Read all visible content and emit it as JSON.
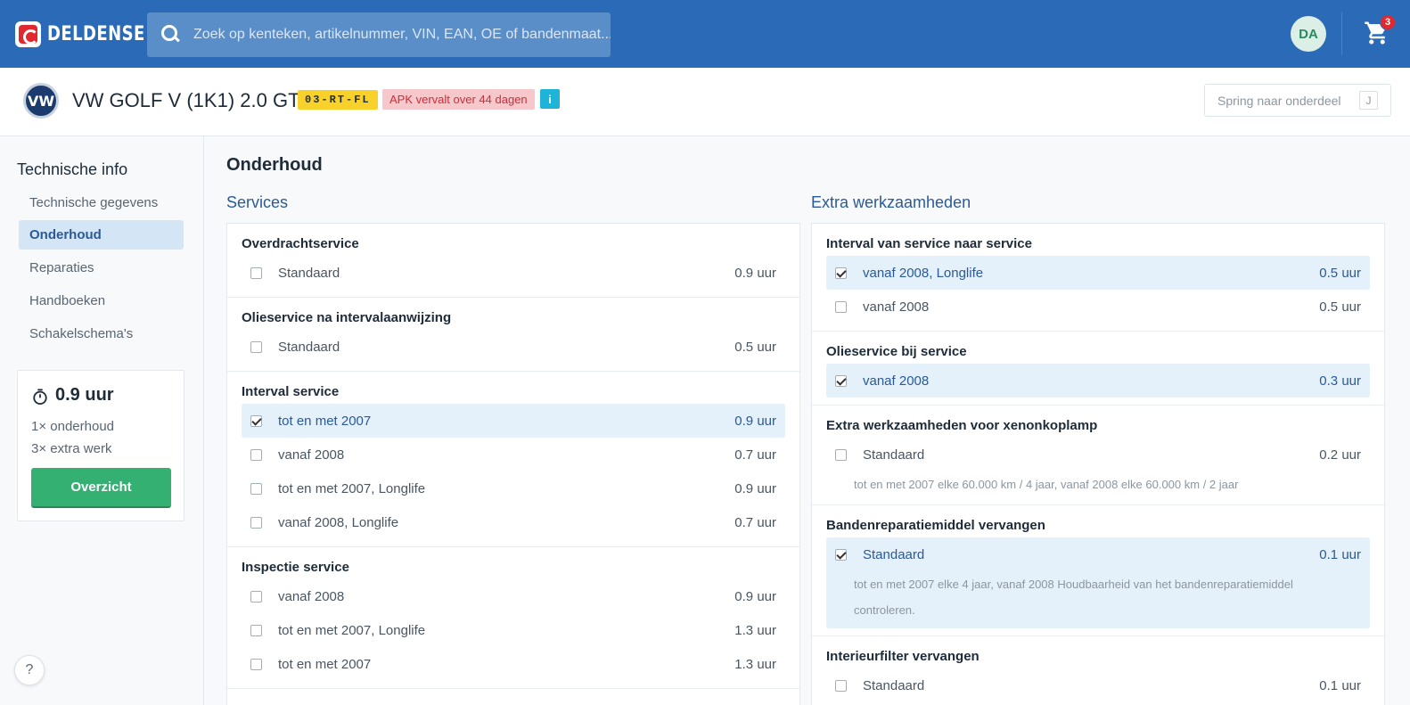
{
  "header": {
    "brand": "DELDENSE",
    "search_placeholder": "Zoek op kenteken, artikelnummer, VIN, EAN, OE of bandenmaat...",
    "avatar_initials": "DA",
    "cart_count": "3"
  },
  "vehicle": {
    "make_logo": "VW",
    "title": "VW GOLF V (1K1) 2.0 GTI",
    "plate": "03-RT-FL",
    "apk": "APK vervalt over 44 dagen",
    "info": "i",
    "jump_label": "Spring naar onderdeel",
    "jump_key": "J"
  },
  "sidebar": {
    "title": "Technische info",
    "items": [
      {
        "label": "Technische gegevens",
        "active": false
      },
      {
        "label": "Onderhoud",
        "active": true
      },
      {
        "label": "Reparaties",
        "active": false
      },
      {
        "label": "Handboeken",
        "active": false
      },
      {
        "label": "Schakelschema's",
        "active": false
      }
    ],
    "summary": {
      "hours": "0.9 uur",
      "line1": "1× onderhoud",
      "line2": "3× extra werk",
      "button": "Overzicht"
    },
    "help": "?"
  },
  "main": {
    "title": "Onderhoud",
    "services_title": "Services",
    "extra_title": "Extra werkzaamheden",
    "services": [
      {
        "title": "Overdrachtservice",
        "options": [
          {
            "label": "Standaard",
            "value": "0.9 uur",
            "checked": false
          }
        ]
      },
      {
        "title": "Olieservice na intervalaanwijzing",
        "options": [
          {
            "label": "Standaard",
            "value": "0.5 uur",
            "checked": false
          }
        ]
      },
      {
        "title": "Interval service",
        "options": [
          {
            "label": "tot en met 2007",
            "value": "0.9 uur",
            "checked": true
          },
          {
            "label": "vanaf 2008",
            "value": "0.7 uur",
            "checked": false
          },
          {
            "label": "tot en met 2007, Longlife",
            "value": "0.9 uur",
            "checked": false
          },
          {
            "label": "vanaf 2008, Longlife",
            "value": "0.7 uur",
            "checked": false
          }
        ]
      },
      {
        "title": "Inspectie service",
        "options": [
          {
            "label": "vanaf 2008",
            "value": "0.9 uur",
            "checked": false
          },
          {
            "label": "tot en met 2007, Longlife",
            "value": "1.3 uur",
            "checked": false
          },
          {
            "label": "tot en met 2007",
            "value": "1.3 uur",
            "checked": false
          }
        ]
      }
    ],
    "extras": [
      {
        "title": "Interval van service naar service",
        "options": [
          {
            "label": "vanaf 2008, Longlife",
            "value": "0.5 uur",
            "checked": true
          },
          {
            "label": "vanaf 2008",
            "value": "0.5 uur",
            "checked": false
          }
        ]
      },
      {
        "title": "Olieservice bij service",
        "options": [
          {
            "label": "vanaf 2008",
            "value": "0.3 uur",
            "checked": true
          }
        ]
      },
      {
        "title": "Extra werkzaamheden voor xenonkoplamp",
        "options": [
          {
            "label": "Standaard",
            "value": "0.2 uur",
            "checked": false,
            "note": "tot en met 2007 elke 60.000 km / 4 jaar, vanaf 2008 elke 60.000 km / 2 jaar"
          }
        ]
      },
      {
        "title": "Bandenreparatiemiddel vervangen",
        "options": [
          {
            "label": "Standaard",
            "value": "0.1 uur",
            "checked": true,
            "note": "tot en met 2007 elke 4 jaar, vanaf 2008 Houdbaarheid van het bandenreparatiemiddel controleren."
          }
        ]
      },
      {
        "title": "Interieurfilter vervangen",
        "options": [
          {
            "label": "Standaard",
            "value": "0.1 uur",
            "checked": false
          }
        ]
      }
    ]
  },
  "colors": {
    "header_bg": "#2a6ab6",
    "accent": "#2a5a98",
    "selected_bg": "#e4f0fa",
    "button_green": "#33b072",
    "plate_yellow": "#f8d22b",
    "apk_red": "#c8303a"
  }
}
